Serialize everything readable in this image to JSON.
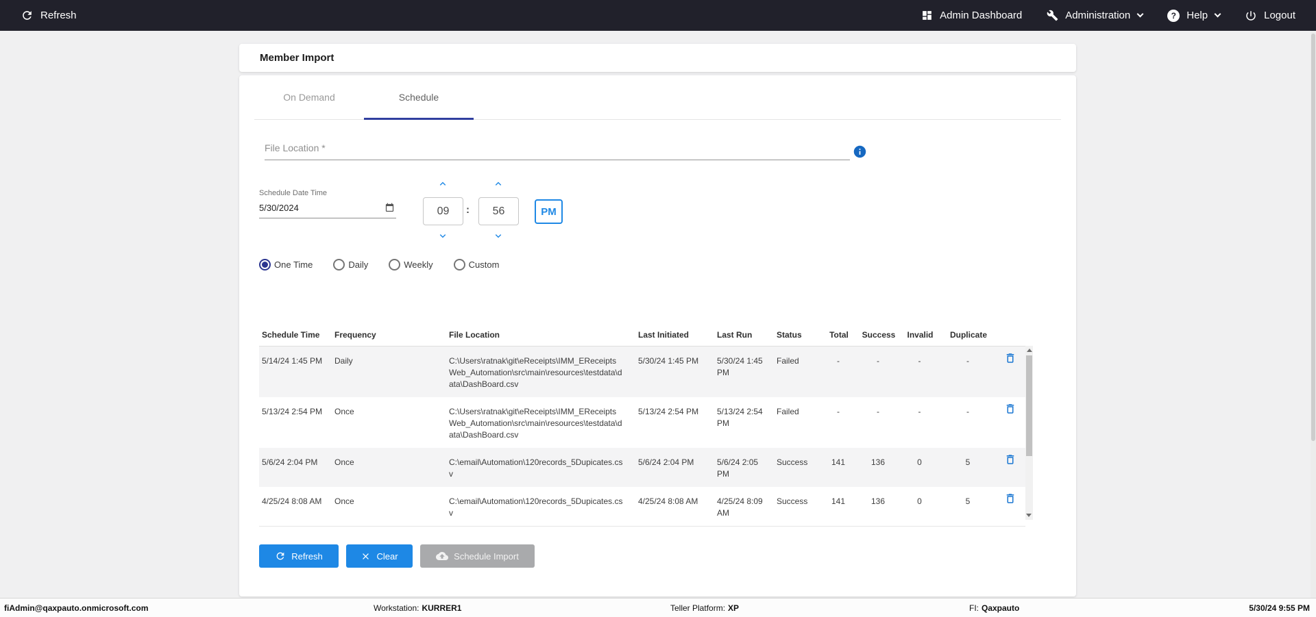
{
  "colors": {
    "topbar_bg": "#21212b",
    "accent_blue": "#1e88e5",
    "tab_underline": "#303f9f",
    "radio_selected": "#2b3590",
    "disabled_button": "#a9aaac",
    "trash_icon": "#1976d2",
    "page_bg": "#f0f0f1"
  },
  "topbar": {
    "refresh_label": "Refresh",
    "admin_dashboard_label": "Admin Dashboard",
    "administration_label": "Administration",
    "help_label": "Help",
    "logout_label": "Logout"
  },
  "page": {
    "title": "Member Import"
  },
  "tabs": [
    {
      "label": "On Demand",
      "active": false
    },
    {
      "label": "Schedule",
      "active": true
    }
  ],
  "form": {
    "file_location": {
      "placeholder": "File Location *",
      "value": ""
    },
    "schedule_date_time": {
      "label": "Schedule Date Time",
      "date_value": "5/30/2024",
      "hour": "09",
      "minute": "56",
      "meridiem": "PM"
    },
    "frequency_options": [
      {
        "label": "One Time",
        "selected": true
      },
      {
        "label": "Daily",
        "selected": false
      },
      {
        "label": "Weekly",
        "selected": false
      },
      {
        "label": "Custom",
        "selected": false
      }
    ]
  },
  "table": {
    "columns": [
      "Schedule Time",
      "Frequency",
      "File Location",
      "Last Initiated",
      "Last Run",
      "Status",
      "Total",
      "Success",
      "Invalid",
      "Duplicate"
    ],
    "rows": [
      {
        "schedule_time": "5/14/24 1:45 PM",
        "frequency": "Daily",
        "file_location": "C:\\Users\\ratnak\\git\\eReceipts\\IMM_EReceiptsWeb_Automation\\src\\main\\resources\\testdata\\data\\DashBoard.csv",
        "last_initiated": "5/30/24 1:45 PM",
        "last_run": "5/30/24 1:45 PM",
        "status": "Failed",
        "total": "-",
        "success": "-",
        "invalid": "-",
        "duplicate": "-"
      },
      {
        "schedule_time": "5/13/24 2:54 PM",
        "frequency": "Once",
        "file_location": "C:\\Users\\ratnak\\git\\eReceipts\\IMM_EReceiptsWeb_Automation\\src\\main\\resources\\testdata\\data\\DashBoard.csv",
        "last_initiated": "5/13/24 2:54 PM",
        "last_run": "5/13/24 2:54 PM",
        "status": "Failed",
        "total": "-",
        "success": "-",
        "invalid": "-",
        "duplicate": "-"
      },
      {
        "schedule_time": "5/6/24 2:04 PM",
        "frequency": "Once",
        "file_location": "C:\\email\\Automation\\120records_5Dupicates.csv",
        "last_initiated": "5/6/24 2:04 PM",
        "last_run": "5/6/24 2:05 PM",
        "status": "Success",
        "total": "141",
        "success": "136",
        "invalid": "0",
        "duplicate": "5"
      },
      {
        "schedule_time": "4/25/24 8:08 AM",
        "frequency": "Once",
        "file_location": "C:\\email\\Automation\\120records_5Dupicates.csv",
        "last_initiated": "4/25/24 8:08 AM",
        "last_run": "4/25/24 8:09 AM",
        "status": "Success",
        "total": "141",
        "success": "136",
        "invalid": "0",
        "duplicate": "5"
      }
    ]
  },
  "actions": {
    "refresh_label": "Refresh",
    "clear_label": "Clear",
    "schedule_import_label": "Schedule Import"
  },
  "footer": {
    "user": "fiAdmin@qaxpauto.onmicrosoft.com",
    "workstation_label": "Workstation:",
    "workstation_value": "KURRER1",
    "teller_platform_label": "Teller Platform:",
    "teller_platform_value": "XP",
    "fi_label": "FI:",
    "fi_value": "Qaxpauto",
    "datetime": "5/30/24 9:55 PM"
  },
  "icons": {
    "refresh-icon": "↻",
    "dashboard-icon": "grid of squares",
    "wrench-icon": "wrench",
    "help-icon": "? in circle",
    "chevron-down-icon": "⌄",
    "power-icon": "power symbol",
    "info-icon": "i in filled circle",
    "calendar-icon": "calendar",
    "chevron-up-icon": "︿",
    "close-icon": "×",
    "cloud-upload-icon": "cloud with up arrow",
    "trash-icon": "trash can"
  }
}
